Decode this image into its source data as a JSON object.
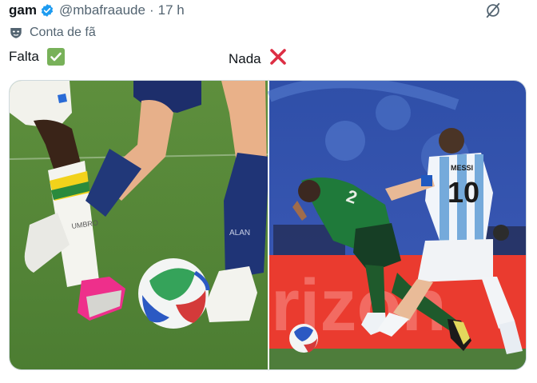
{
  "post": {
    "author_name": "gam",
    "handle": "@mbafraaude",
    "separator": "·",
    "time": "17 h",
    "badge_label": "Conta de fã",
    "caption_left": "Falta",
    "caption_right": "Nada"
  },
  "icons": {
    "verified": "verified-badge-icon",
    "grok": "grok-icon",
    "fan": "fan-account-mask-icon",
    "check": "check-mark-emoji",
    "cross": "cross-mark-emoji"
  },
  "photo_left": {
    "sock_text": "UMBRO",
    "sock_text_2": "ALAN"
  },
  "photo_right": {
    "jersey_name": "MESSI",
    "jersey_number": "10",
    "board_text": "rizon"
  },
  "colors": {
    "verified": "#1d9bf0",
    "muted": "#536471",
    "check": "#78b159",
    "cross": "#dd2e44"
  }
}
